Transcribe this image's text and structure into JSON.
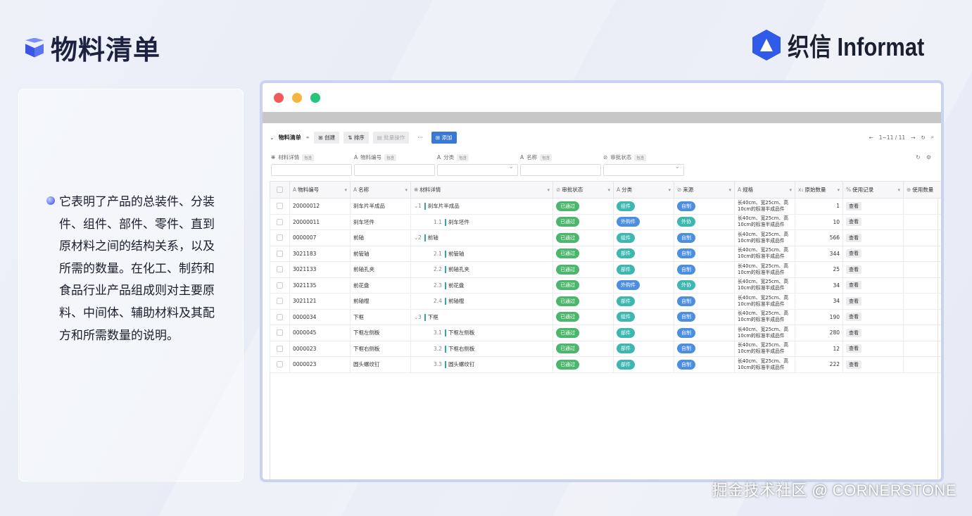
{
  "header": {
    "title": "物料清单",
    "brand": "织信 Informat"
  },
  "description": "它表明了产品的总装件、分装件、组件、部件、零件、直到原材料之间的结构关系，以及所需的数量。在化工、制药和食品行业产品组成则对主要原料、中间体、辅助材料及其配方和所需数量的说明。",
  "window": {
    "dots": [
      "#f05a5a",
      "#f4b63f",
      "#27c47c"
    ],
    "toolbar": {
      "title": "物料清单",
      "create": "创建",
      "sort": "排序",
      "batch": "批量操作",
      "more": "···",
      "add": "添加",
      "pagination": "1~11 / 11"
    },
    "filters": [
      {
        "label": "材料详情",
        "tag": "包含",
        "select": false
      },
      {
        "label": "物料编号",
        "tag": "包含",
        "select": false
      },
      {
        "label": "分类",
        "tag": "包含",
        "select": true
      },
      {
        "label": "名称",
        "tag": "包含",
        "select": false
      },
      {
        "label": "审批状态",
        "tag": "包含",
        "select": true
      }
    ],
    "columns": [
      "物料编号",
      "名称",
      "材料详情",
      "审批状态",
      "分类",
      "来源",
      "规格",
      "原始数量",
      "使用记录",
      "使用数量"
    ],
    "column_icons": [
      "A",
      "A",
      "❋",
      "⊘",
      "A",
      "⊘",
      "A",
      "x₁",
      "%",
      "⊕"
    ],
    "view_label": "查看",
    "spec_text": "长40cm、宽25cm、高10cm的标准半成品件",
    "rows": [
      {
        "code": "20000012",
        "name": "刹车片半成品",
        "idx": "1",
        "detail": "刹车片半成品",
        "expand": true,
        "status": "已通过",
        "category": "组件",
        "source": "自制",
        "qty": "1"
      },
      {
        "code": "20000011",
        "name": "刹车坯件",
        "idx": "1.1",
        "detail": "刹车坯件",
        "expand": false,
        "status": "已通过",
        "category": "外购件",
        "source": "外协",
        "qty": "10"
      },
      {
        "code": "0000007",
        "name": "前轴",
        "idx": "2",
        "detail": "前轴",
        "expand": true,
        "status": "已通过",
        "category": "组件",
        "source": "自制",
        "qty": "566"
      },
      {
        "code": "3021183",
        "name": "前管轴",
        "idx": "2.1",
        "detail": "前管轴",
        "expand": false,
        "status": "已通过",
        "category": "部件",
        "source": "自制",
        "qty": "344"
      },
      {
        "code": "3021133",
        "name": "前轴孔夹",
        "idx": "2.2",
        "detail": "前轴孔夹",
        "expand": false,
        "status": "已通过",
        "category": "部件",
        "source": "自制",
        "qty": "25"
      },
      {
        "code": "3021135",
        "name": "前花盘",
        "idx": "2.3",
        "detail": "前花盘",
        "expand": false,
        "status": "已通过",
        "category": "外购件",
        "source": "外协",
        "qty": "34"
      },
      {
        "code": "3021121",
        "name": "前轴棍",
        "idx": "2.4",
        "detail": "前轴棍",
        "expand": false,
        "status": "已通过",
        "category": "部件",
        "source": "自制",
        "qty": "34"
      },
      {
        "code": "0000034",
        "name": "下框",
        "idx": "3",
        "detail": "下框",
        "expand": true,
        "status": "已通过",
        "category": "组件",
        "source": "自制",
        "qty": "190"
      },
      {
        "code": "0000045",
        "name": "下框左侧板",
        "idx": "3.1",
        "detail": "下框左侧板",
        "expand": false,
        "status": "已通过",
        "category": "部件",
        "source": "自制",
        "qty": "280"
      },
      {
        "code": "0000023",
        "name": "下框右侧板",
        "idx": "3.2",
        "detail": "下框右侧板",
        "expand": false,
        "status": "已通过",
        "category": "部件",
        "source": "自制",
        "qty": "12"
      },
      {
        "code": "0000023",
        "name": "圆头螺纹钉",
        "idx": "3.3",
        "detail": "圆头螺纹钉",
        "expand": false,
        "status": "已通过",
        "category": "部件",
        "source": "自制",
        "qty": "222"
      }
    ]
  },
  "watermark": "掘金技术社区 @ CORNERSTONE"
}
